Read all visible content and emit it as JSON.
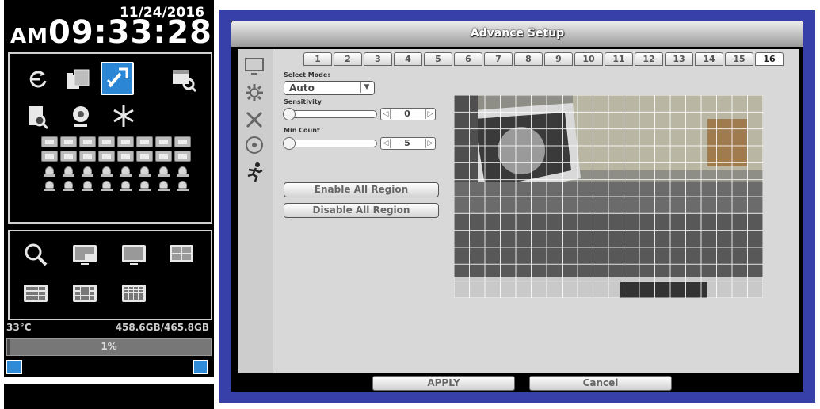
{
  "clock": {
    "date": "11/24/2016",
    "ampm": "AM",
    "time": "09:33:28"
  },
  "status": {
    "temperature": "33°C",
    "disk": "458.6GB/465.8GB",
    "usage_percent": 1,
    "usage_label": "1%"
  },
  "dialog": {
    "title": "Advance Setup"
  },
  "tabs": [
    "1",
    "2",
    "3",
    "4",
    "5",
    "6",
    "7",
    "8",
    "9",
    "10",
    "11",
    "12",
    "13",
    "14",
    "15",
    "16"
  ],
  "selected_tab": "16",
  "form": {
    "select_mode_label": "Select Mode:",
    "select_mode_value": "Auto",
    "sensitivity_label": "Sensitivity",
    "sensitivity_value": "0",
    "min_count_label": "Min Count",
    "min_count_value": "5",
    "enable_all_label": "Enable All Region",
    "disable_all_label": "Disable All Region"
  },
  "footer": {
    "apply_label": "APPLY",
    "cancel_label": "Cancel"
  },
  "colors": {
    "frame_blue": "#3640a8",
    "active_icon_blue": "#2c86d6",
    "panel_gray": "#d8d8d8"
  }
}
